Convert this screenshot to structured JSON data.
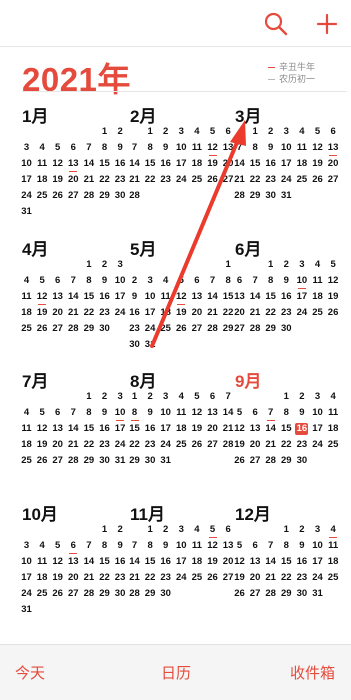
{
  "header": {
    "search_icon": "search-icon",
    "add_icon": "plus-icon"
  },
  "year_title": "2021年",
  "legend": {
    "items": [
      {
        "label": "辛丑牛年",
        "color": "#e54b3c"
      },
      {
        "label": "农历初一",
        "color": "#b9b9b9"
      }
    ]
  },
  "colors": {
    "accent": "#e54b3c",
    "text": "#111111"
  },
  "today": {
    "month": 9,
    "day": 16
  },
  "months": [
    {
      "label": "1月",
      "first_weekday": 5,
      "days": 31
    },
    {
      "label": "2月",
      "first_weekday": 1,
      "days": 28
    },
    {
      "label": "3月",
      "first_weekday": 1,
      "days": 31
    },
    {
      "label": "4月",
      "first_weekday": 4,
      "days": 30
    },
    {
      "label": "5月",
      "first_weekday": 6,
      "days": 31
    },
    {
      "label": "6月",
      "first_weekday": 2,
      "days": 30
    },
    {
      "label": "7月",
      "first_weekday": 4,
      "days": 31
    },
    {
      "label": "8月",
      "first_weekday": 0,
      "days": 31
    },
    {
      "label": "9月",
      "first_weekday": 3,
      "days": 30
    },
    {
      "label": "10月",
      "first_weekday": 5,
      "days": 31
    },
    {
      "label": "11月",
      "first_weekday": 1,
      "days": 30
    },
    {
      "label": "12月",
      "first_weekday": 3,
      "days": 31
    }
  ],
  "term_marks": [
    {
      "month": 1,
      "day": 13
    },
    {
      "month": 2,
      "day": 12
    },
    {
      "month": 3,
      "day": 13
    },
    {
      "month": 4,
      "day": 12
    },
    {
      "month": 5,
      "day": 12
    },
    {
      "month": 6,
      "day": 10
    },
    {
      "month": 7,
      "day": 10
    },
    {
      "month": 8,
      "day": 8
    },
    {
      "month": 9,
      "day": 7
    },
    {
      "month": 10,
      "day": 6
    },
    {
      "month": 11,
      "day": 5
    },
    {
      "month": 12,
      "day": 4
    }
  ],
  "tabs": {
    "today_label": "今天",
    "calendars_label": "日历",
    "inbox_label": "收件箱"
  }
}
